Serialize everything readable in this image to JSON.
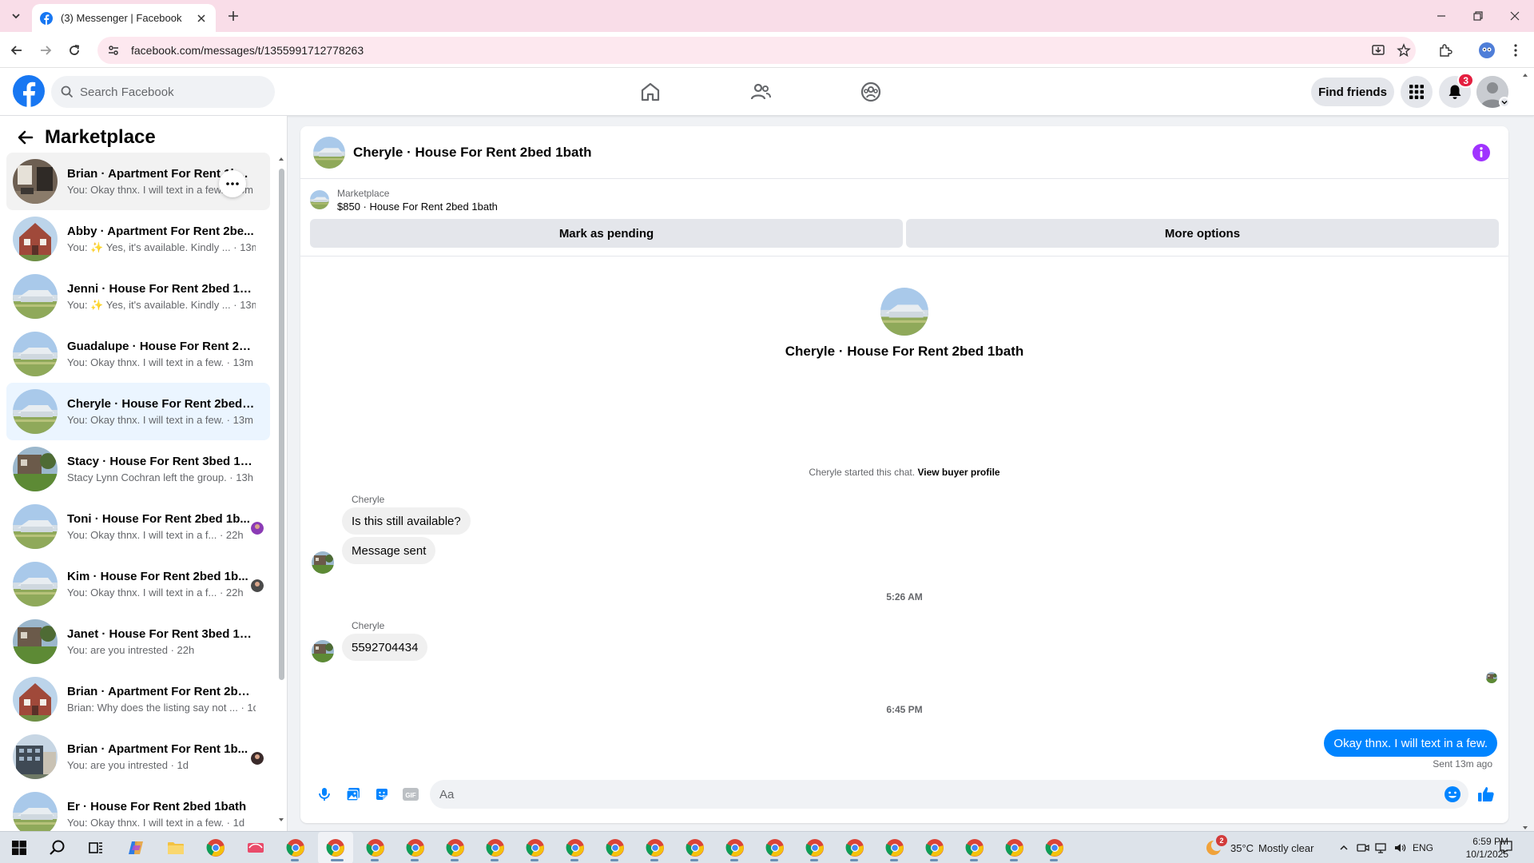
{
  "browser": {
    "tab_title": "(3) Messenger | Facebook",
    "url": "facebook.com/messages/t/1355991712778263"
  },
  "header": {
    "search_placeholder": "Search Facebook",
    "find_friends": "Find friends",
    "notification_count": "3"
  },
  "sidebar": {
    "title": "Marketplace",
    "conversations": [
      {
        "name": "Brian · Apartment For Rent 1b...",
        "snippet": "You: Okay thnx. I will text in a few. · 13m",
        "thumb": "interior"
      },
      {
        "name": "Abby · Apartment For Rent 2be...",
        "snippet": "You: ✨ Yes, it's available. Kindly ... · 13m",
        "thumb": "brick"
      },
      {
        "name": "Jenni · House For Rent 2bed 1bath",
        "snippet": "You: ✨ Yes, it's available. Kindly ... · 13m",
        "thumb": "house"
      },
      {
        "name": "Guadalupe · House For Rent 2be...",
        "snippet": "You: Okay thnx. I will text in a few. · 13m",
        "thumb": "house"
      },
      {
        "name": "Cheryle · House For Rent 2bed 1...",
        "snippet": "You: Okay thnx. I will text in a few. · 13m",
        "thumb": "house"
      },
      {
        "name": "Stacy · House For Rent 3bed 1bath",
        "snippet": "Stacy Lynn Cochran left the group. · 13h",
        "thumb": "yard"
      },
      {
        "name": "Toni · House For Rent 2bed 1b...",
        "snippet": "You: Okay thnx. I will text in a f... · 22h",
        "thumb": "house"
      },
      {
        "name": "Kim · House For Rent 2bed 1b...",
        "snippet": "You: Okay thnx. I will text in a f... · 22h",
        "thumb": "house"
      },
      {
        "name": "Janet · House For Rent 3bed 1bath",
        "snippet": "You: are you intrested · 22h",
        "thumb": "yard"
      },
      {
        "name": "Brian · Apartment For Rent 2bed...",
        "snippet": "Brian: Why does the listing say not ... · 1d",
        "thumb": "brick"
      },
      {
        "name": "Brian · Apartment For Rent 1b...",
        "snippet": "You: are you intrested · 1d",
        "thumb": "building"
      },
      {
        "name": "Er · House For Rent 2bed 1bath",
        "snippet": "You: Okay thnx. I will text in a few. · 1d",
        "thumb": "house"
      }
    ]
  },
  "chat": {
    "title": "Cheryle · House For Rent 2bed 1bath",
    "listing_category": "Marketplace",
    "listing_price": "$850 · House For Rent 2bed 1bath",
    "mark_pending": "Mark as pending",
    "more_options": "More options",
    "intro_title": "Cheryle · House For Rent 2bed 1bath",
    "started_text": "Cheryle started this chat.",
    "view_profile": "View buyer profile",
    "sender1": "Cheryle",
    "msg1": "Is this still available?",
    "msg2": "Message sent",
    "time1": "5:26 AM",
    "sender2": "Cheryle",
    "msg3": "5592704434",
    "time2": "6:45 PM",
    "msg_out": "Okay thnx. I will text in a few.",
    "sent_status": "Sent 13m ago",
    "composer_placeholder": "Aa"
  },
  "taskbar": {
    "temperature": "35°C",
    "weather": "Mostly clear",
    "weather_badge": "2",
    "language": "ENG",
    "time": "6:59 PM",
    "date": "10/1/2025"
  },
  "colors": {
    "fb_blue": "#1877f2",
    "messenger_blue": "#0084ff",
    "info_purple": "#a033ff",
    "tab_pink": "#f9dde8"
  }
}
